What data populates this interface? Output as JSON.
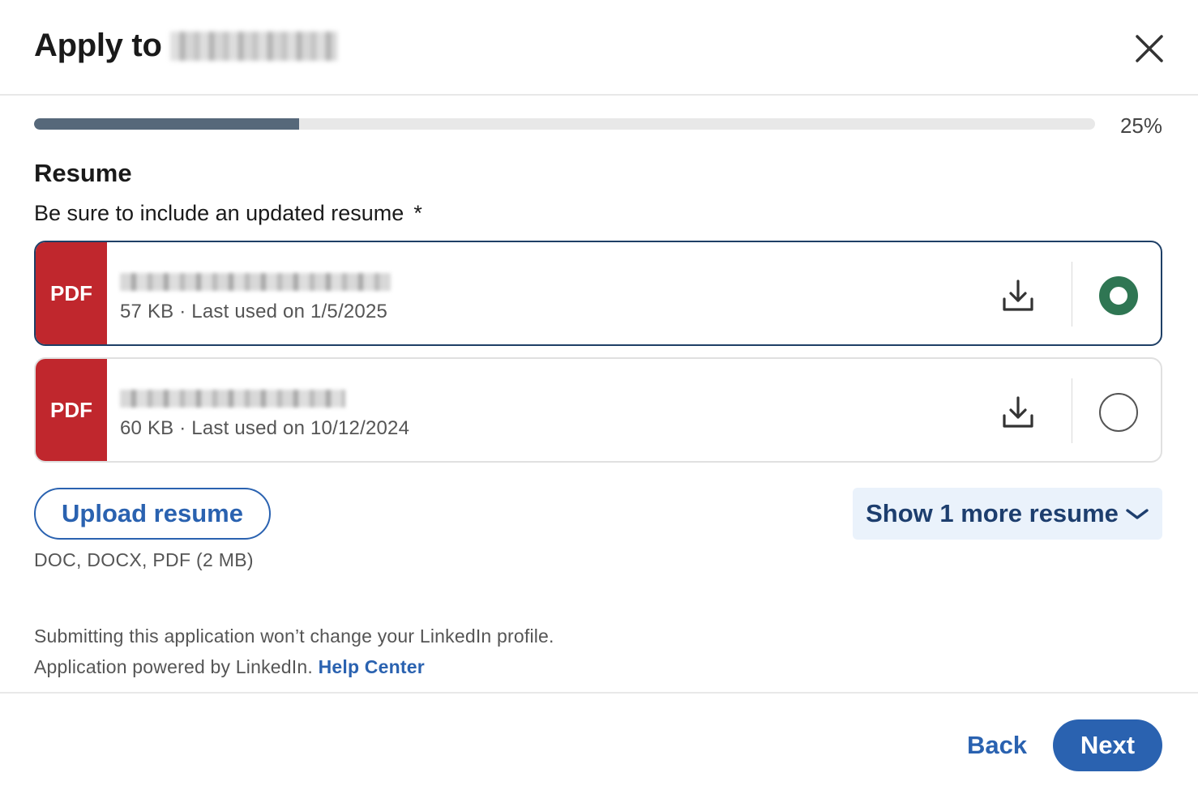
{
  "dialog": {
    "title": "Apply to",
    "close_icon": "close-icon"
  },
  "progress": {
    "percent": 25,
    "label": "25%"
  },
  "section": {
    "title": "Resume",
    "description": "Be sure to include an updated resume",
    "required_marker": "*"
  },
  "resumes": [
    {
      "badge": "PDF",
      "meta": "57 KB · Last used on 1/5/2025",
      "selected": true,
      "download_icon": "download-icon"
    },
    {
      "badge": "PDF",
      "meta": "60 KB · Last used on 10/12/2024",
      "selected": false,
      "download_icon": "download-icon"
    }
  ],
  "upload": {
    "button_label": "Upload resume",
    "hint": "DOC, DOCX, PDF (2 MB)"
  },
  "show_more": {
    "label": "Show 1 more resume",
    "icon": "chevron-down-icon"
  },
  "footer": {
    "note": "Submitting this application won’t change your LinkedIn profile.",
    "powered_by": "Application powered by LinkedIn.",
    "help_link": "Help Center"
  },
  "actions": {
    "back_label": "Back",
    "next_label": "Next"
  },
  "colors": {
    "accent": "#2a62b0",
    "pdf_badge": "#c0272d",
    "radio_checked": "#2f7653",
    "progress_fill": "#56687a"
  }
}
